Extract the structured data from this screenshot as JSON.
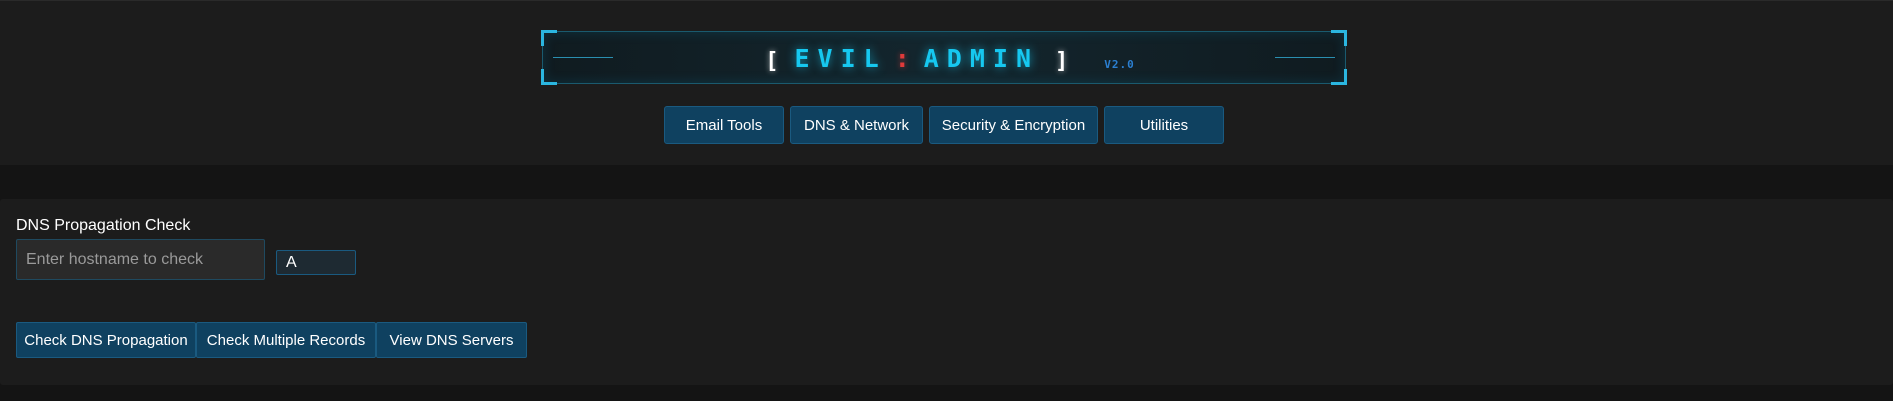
{
  "header": {
    "logo": {
      "bracket_open": "[",
      "word1": "EVIL",
      "separator": ":",
      "word2": "ADMIN",
      "bracket_close": "]",
      "version": "V2.0"
    },
    "nav": [
      {
        "label": "Email Tools"
      },
      {
        "label": "DNS & Network"
      },
      {
        "label": "Security & Encryption"
      },
      {
        "label": "Utilities"
      }
    ]
  },
  "panel": {
    "title": "DNS Propagation Check",
    "hostname_input": {
      "value": "",
      "placeholder": "Enter hostname to check"
    },
    "record_type": {
      "selected": "A"
    },
    "buttons": [
      {
        "label": "Check DNS Propagation"
      },
      {
        "label": "Check Multiple Records"
      },
      {
        "label": "View DNS Servers"
      }
    ]
  },
  "colors": {
    "accent": "#16c8f0",
    "button_bg": "#0f4160",
    "separator": "#e03a3a"
  }
}
